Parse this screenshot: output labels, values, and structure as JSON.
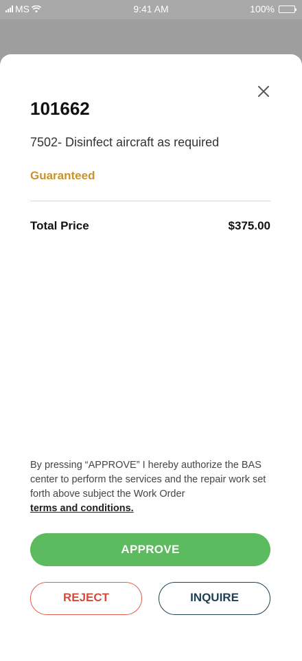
{
  "status_bar": {
    "carrier": "MS",
    "time": "9:41 AM",
    "battery": "100%"
  },
  "sheet": {
    "order_number": "101662",
    "description": "7502- Disinfect aircraft as required",
    "status": "Guaranteed",
    "price_label": "Total Price",
    "price_value": "$375.00",
    "authorization_text": "By pressing “APPROVE” I hereby authorize the BAS center to perform the services and the repair work set forth above subject the Work Order",
    "terms_link": "terms and conditions.",
    "approve_label": "APPROVE",
    "reject_label": "REJECT",
    "inquire_label": "INQUIRE"
  },
  "colors": {
    "approve": "#5cbb5e",
    "reject": "#d64a3a",
    "inquire": "#1f3e52",
    "guaranteed": "#c9932a"
  }
}
